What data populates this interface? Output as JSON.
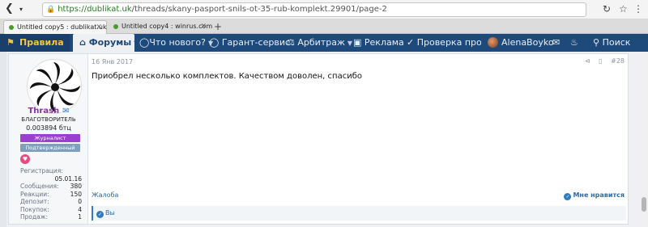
{
  "browser": {
    "back_icon": "back-arrow-icon",
    "forward_icon": "dropdown-caret-icon",
    "url_prefix": "https://",
    "url_host": "dublikat.uk",
    "url_path": "/threads/skany-pasport-snils-ot-35-rub-komplekt.29901/page-2",
    "tabs": [
      {
        "label": "Untitled copy5 : dublikat.uk"
      },
      {
        "label": "Untitled copy4 : winrus.com"
      }
    ],
    "new_tab": "+"
  },
  "navbar": {
    "items": [
      {
        "label": "Правила"
      },
      {
        "label": "Форумы"
      },
      {
        "label": "Что нового?"
      },
      {
        "label": "Гарант-сервис"
      },
      {
        "label": "Арбитраж"
      },
      {
        "label": "Реклама"
      },
      {
        "label": "Проверка про"
      },
      {
        "label": "AlenaBoyko"
      },
      {
        "label": "Поиск"
      }
    ]
  },
  "user": {
    "name": "Thrash",
    "title": "БЛАГОТВОРИТЕЛЬ",
    "balance": "0.003894 бтц",
    "badges": [
      "Журналист",
      "Подтвержденный"
    ],
    "stats": [
      {
        "label": "Регистрация:",
        "value": ""
      },
      {
        "label": "",
        "value": "05.01.16"
      },
      {
        "label": "Сообщения:",
        "value": "380"
      },
      {
        "label": "Реакции:",
        "value": "150"
      },
      {
        "label": "Депозит:",
        "value": "0"
      },
      {
        "label": "Покупок:",
        "value": "4"
      },
      {
        "label": "Продаж:",
        "value": "1"
      }
    ]
  },
  "post": {
    "date": "16 Янв 2017",
    "number": "#28",
    "text": "Приобрел несколько комплектов. Качеством доволен, спасибо",
    "report": "Жалоба",
    "like": "Мне нравится",
    "reactions": "Вы"
  },
  "colors": {
    "navbar": "#1e4a7b",
    "username": "#8a2fa8",
    "badge_journalist": "#9b3fd1",
    "badge_verified": "#7f9fbd",
    "link": "#2f6ba8"
  }
}
